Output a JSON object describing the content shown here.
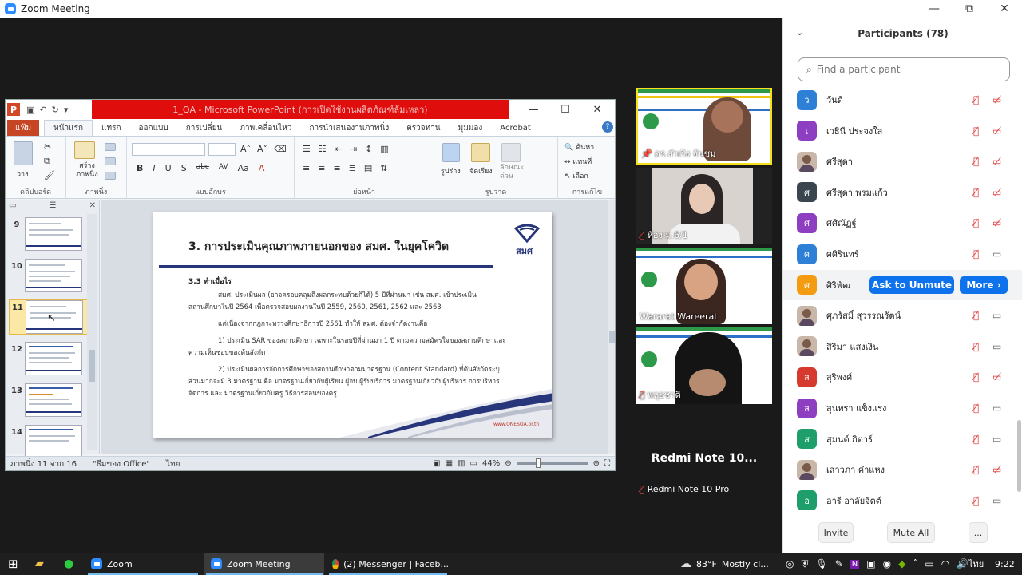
{
  "window": {
    "title": "Zoom Meeting",
    "minimize": "—",
    "restore": "⧉",
    "close": "✕"
  },
  "ppt": {
    "window_title": "1_QA - Microsoft PowerPoint (การเปิดใช้งานผลิตภัณฑ์ล้มเหลว)",
    "app_letter": "P",
    "tabs": [
      "แฟ้ม",
      "หน้าแรก",
      "แทรก",
      "ออกแบบ",
      "การเปลี่ยน",
      "ภาพเคลื่อนไหว",
      "การนำเสนองานภาพนิ่ง",
      "ตรวจทาน",
      "มุมมอง",
      "Acrobat"
    ],
    "ribbon_groups": [
      "คลิปบอร์ด",
      "ภาพนิ่ง",
      "แบบอักษร",
      "ย่อหน้า",
      "รูปวาด",
      "การแก้ไข"
    ],
    "ribbon_labels": {
      "paste": "วาง",
      "new_slide": "สร้าง ภาพนิ่ง",
      "arrange": "จัดเรียง",
      "shapes": "รูปร่าง",
      "quick_styles": "ลักษณะ ด่วน",
      "find": "ค้นหา",
      "replace": "แทนที่",
      "select": "เลือก"
    },
    "thumbnails": [
      "9",
      "10",
      "11",
      "12",
      "13",
      "14"
    ],
    "slide": {
      "title": "3. การประเมินคุณภาพภายนอกของ สมศ. ในยุคโควิด",
      "logo_text": "สมศ",
      "subtitle": "3.3 ทำเมื่อไร",
      "lines": [
        "สมศ. ประเมินผล (อาจครอบคลุมถึงผลกระทบด้วยก็ได้) 5 ปีที่ผ่านมา เช่น สมศ. เข้าประเมิน",
        "สถานศึกษาในปี 2564 เพื่อตรวจสอบผลงานในปี 2559, 2560, 2561, 2562 และ 2563",
        "แต่เนื่องจากกฎกระทรวงศึกษาธิการปี 2561 ทำให้ สมศ. ต้องจำกัดงานคือ",
        "1) ประเมิน SAR ของสถานศึกษา เฉพาะในรอบปีที่ผ่านมา 1 ปี ตามความสมัครใจของสถานศึกษาและ",
        "ความเห็นชอบของต้นสังกัด",
        "2) ประเมินผลการจัดการศึกษาของสถานศึกษาตามมาตรฐาน (Content Standard) ที่ต้นสังกัดระบุ",
        "ส่วนมากจะมี 3 มาตรฐาน คือ มาตรฐานเกี่ยวกับผู้เรียน ผู้จบ ผู้รับบริการ มาตรฐานเกี่ยวกับผู้บริหาร การบริหาร",
        "จัดการ และ มาตรฐานเกี่ยวกับครู วิธีการสอนของครู"
      ],
      "url": "www.ONESQA.or.th"
    },
    "status": {
      "slide_of": "ภาพนิ่ง 11 จาก 16",
      "theme": "\"ธีมของ Office\"",
      "lang": "ไทย",
      "zoom": "44%"
    }
  },
  "gallery": [
    {
      "name": "ดร.สำเริง จันชม",
      "muted": false
    },
    {
      "name": "ห้อง ม.6/1",
      "muted": true
    },
    {
      "name": "Wararat Wareerat",
      "muted": false
    },
    {
      "name": "พหุธชาติ",
      "muted": true
    },
    {
      "name": "Redmi Note 10 Pro",
      "big": "Redmi Note 10...",
      "muted": true
    }
  ],
  "participants_panel": {
    "title": "Participants (78)",
    "search_placeholder": "Find a participant",
    "participants": [
      {
        "initial": "ว",
        "name": "วันดี",
        "color": "#2e7fd6",
        "video": "off"
      },
      {
        "initial": "เ",
        "name": "เวธินี ประจงใส",
        "color": "#8e3fc1",
        "video": "off"
      },
      {
        "initial": "",
        "name": "ศรีสุดา",
        "color": "",
        "video": "off",
        "photo": true
      },
      {
        "initial": "ศ",
        "name": "ศรีสุดา พรมแก้ว",
        "color": "#3a4550",
        "video": "off"
      },
      {
        "initial": "ศ",
        "name": "ศศิณัฏฐ์",
        "color": "#8e3fc1",
        "video": "off"
      },
      {
        "initial": "ศ",
        "name": "ศศิรินทร์",
        "color": "#2e7fd6",
        "video": "on"
      },
      {
        "initial": "ศ",
        "name": "ศิริพัฒ",
        "color": "#f39c12",
        "video": "off",
        "hover": true
      },
      {
        "initial": "",
        "name": "ศุภรัสมิ์ สุวรรณรัตน์",
        "color": "",
        "video": "on",
        "photo": true
      },
      {
        "initial": "",
        "name": "สิริมา แสงเงิน",
        "color": "",
        "video": "on",
        "photo": true
      },
      {
        "initial": "ส",
        "name": "สุริพงศ์",
        "color": "#d63a2e",
        "video": "off"
      },
      {
        "initial": "ส",
        "name": "สุนทรา แข็งแรง",
        "color": "#8e3fc1",
        "video": "on"
      },
      {
        "initial": "ส",
        "name": "สุมนต์ กิตาร์",
        "color": "#1e9e6a",
        "video": "on"
      },
      {
        "initial": "",
        "name": "เสาวภา คำแหง",
        "color": "",
        "video": "off",
        "photo": true
      },
      {
        "initial": "อ",
        "name": "อารี อาลัยจิตต์",
        "color": "#1e9e6a",
        "video": "on"
      }
    ],
    "ask_to_unmute": "Ask to Unmute",
    "more": "More ›",
    "invite": "Invite",
    "mute_all": "Mute All",
    "overflow": "..."
  },
  "taskbar": {
    "zoom": "Zoom",
    "zoom_meeting": "Zoom Meeting",
    "messenger": "(2) Messenger | Faceb...",
    "weather_temp": "83°F",
    "weather_text": "Mostly cl...",
    "lang": "ไทย",
    "time": "9:22"
  },
  "colors": {
    "zoom_blue": "#0e72ed",
    "ppt_red": "#e00d0d",
    "slide_navy": "#27367a"
  }
}
